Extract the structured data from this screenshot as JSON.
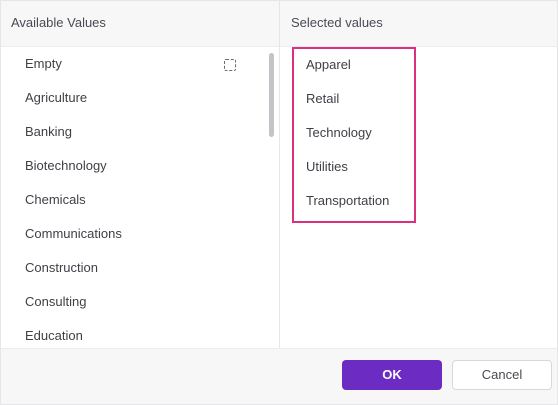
{
  "available": {
    "title": "Available Values",
    "items": [
      "Empty",
      "Agriculture",
      "Banking",
      "Biotechnology",
      "Chemicals",
      "Communications",
      "Construction",
      "Consulting",
      "Education"
    ]
  },
  "selected": {
    "title": "Selected values",
    "items": [
      "Apparel",
      "Retail",
      "Technology",
      "Utilities",
      "Transportation"
    ]
  },
  "footer": {
    "ok_label": "OK",
    "cancel_label": "Cancel"
  },
  "colors": {
    "primary": "#6c2bc2",
    "highlight_border": "#dc2f7e"
  },
  "icons": {
    "row_select": "dashed-square-icon"
  }
}
